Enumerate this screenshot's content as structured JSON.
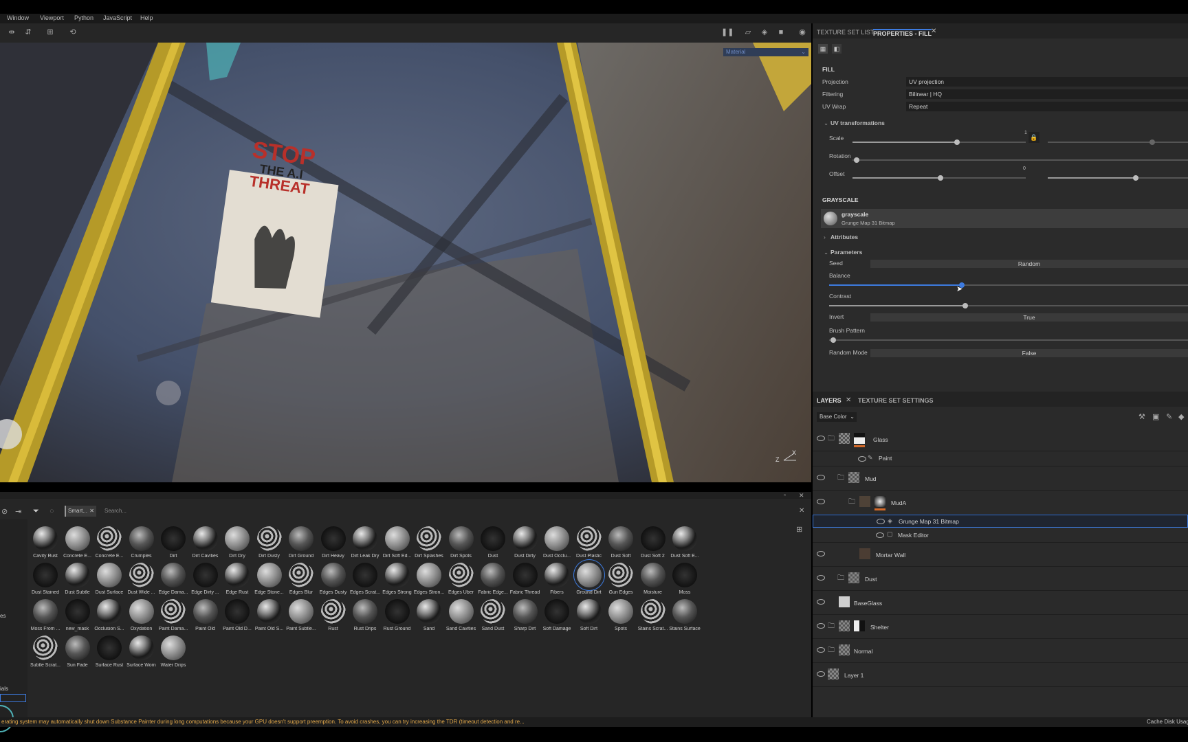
{
  "menu": [
    "Window",
    "Viewport",
    "Python",
    "JavaScript",
    "Help"
  ],
  "viewport": {
    "poster_line1": "STOP",
    "poster_line2": "THE A.I",
    "poster_line3": "THREAT",
    "dropdown": "Material",
    "axis_x": "X",
    "axis_z": "Z"
  },
  "properties": {
    "tab_texture_set_list": "TEXTURE SET LIST",
    "tab_properties": "PROPERTIES - FILL",
    "fill_header": "FILL",
    "projection_label": "Projection",
    "projection_value": "UV projection",
    "filtering_label": "Filtering",
    "filtering_value": "Bilinear | HQ",
    "uvwrap_label": "UV Wrap",
    "uvwrap_value": "Repeat",
    "uv_transformations": "UV transformations",
    "scale_label": "Scale",
    "scale_value": "1",
    "rotation_label": "Rotation",
    "offset_label": "Offset",
    "offset_value": "0",
    "grayscale_header": "GRAYSCALE",
    "grayscale_name": "grayscale",
    "grayscale_source": "Grunge Map 31 Bitmap",
    "attributes": "Attributes",
    "parameters": "Parameters",
    "seed_label": "Seed",
    "seed_value": "Random",
    "balance_label": "Balance",
    "balance_level": 0.37,
    "contrast_label": "Contrast",
    "contrast_level": 0.38,
    "invert_label": "Invert",
    "invert_value": "True",
    "brush_pattern_label": "Brush Pattern",
    "random_mode_label": "Random Mode",
    "random_mode_value": "False"
  },
  "layers": {
    "tab_layers": "LAYERS",
    "tab_texture_set_settings": "TEXTURE SET SETTINGS",
    "channel": "Base Color",
    "rows": [
      {
        "name": "Glass"
      },
      {
        "name": "Paint"
      },
      {
        "name": "Mud"
      },
      {
        "name": "MudA"
      },
      {
        "name": "Grunge Map 31 Bitmap"
      },
      {
        "name": "Mask Editor"
      },
      {
        "name": "Mortar Wall"
      },
      {
        "name": "Dust"
      },
      {
        "name": "BaseGlass"
      },
      {
        "name": "Shelter"
      },
      {
        "name": "Normal"
      },
      {
        "name": "Layer 1"
      }
    ]
  },
  "shelf": {
    "filter_tag": "Smart...",
    "search_placeholder": "Search...",
    "left_text_1": "es",
    "left_text_2": "ials",
    "materials": [
      "Cavity Rust",
      "Concrete E...",
      "Concrete E...",
      "Crumples",
      "Dirt",
      "Dirt Cavities",
      "Dirt Dry",
      "Dirt Dusty",
      "Dirt Ground",
      "Dirt Heavy",
      "Dirt Leak Dry",
      "Dirt Soft Ed...",
      "Dirt Splashes",
      "Dirt Spots",
      "Dust",
      "Dust Dirty",
      "Dust Occlu...",
      "Dust Plastic",
      "Dust Soft",
      "Dust Soft 2",
      "Dust Soft E...",
      "Dust Stained",
      "Dust Subtle",
      "Dust Surface",
      "Dust Wide ...",
      "Edge Dama...",
      "Edge Dirty ...",
      "Edge Rust",
      "Edge Stone...",
      "Edges Blur",
      "Edges Dusty",
      "Edges Scrat...",
      "Edges Strong",
      "Edges Stron...",
      "Edges Uber",
      "Fabric Edge...",
      "Fabric Thread",
      "Fibers",
      "Ground Dirt",
      "Gun Edges",
      "Moisture",
      "Moss",
      "Moss From ...",
      "new_mask",
      "Occlusion S...",
      "Oxydation",
      "Paint Dama...",
      "Paint Old",
      "Paint Old D...",
      "Paint Old S...",
      "Paint Subtle...",
      "Rust",
      "Rust Drips",
      "Rust Ground",
      "Sand",
      "Sand Cavities",
      "Sand Dust",
      "Sharp Dirt",
      "Soft Damage",
      "Soft Dirt",
      "Spots",
      "Stains Scrat...",
      "Stains Surface",
      "Subtle Scrat...",
      "Sun Fade",
      "Surface Rust",
      "Surface Worn",
      "Water Drips"
    ]
  },
  "status": {
    "message": "erating system may automatically shut down Substance Painter during long computations because your GPU doesn't support preemption. To avoid crashes, you can try increasing the TDR (timeout detection and re...",
    "cache": "Cache Disk Usag"
  }
}
